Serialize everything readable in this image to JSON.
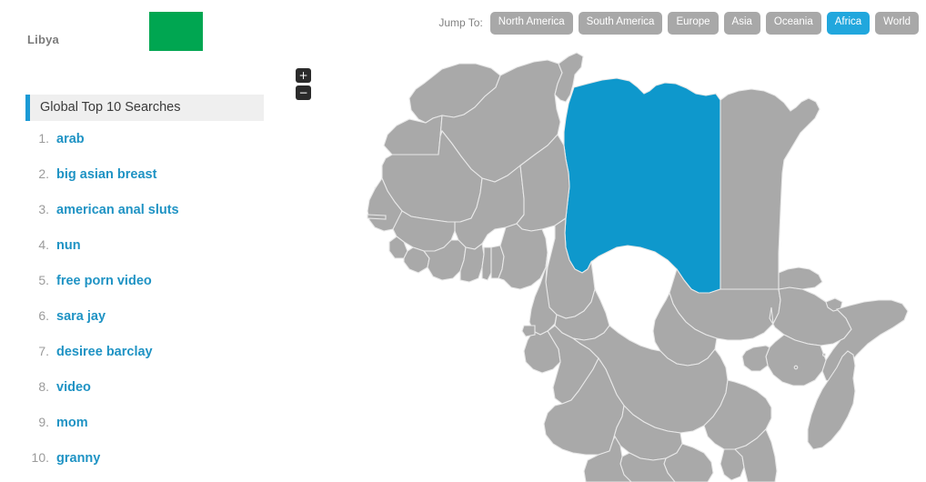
{
  "country": {
    "name": "Libya",
    "flag_color": "#00a651",
    "flag_label": "libya-flag"
  },
  "jump_nav": {
    "label": "Jump To:",
    "buttons": [
      {
        "label": "North America",
        "active": false
      },
      {
        "label": "South America",
        "active": false
      },
      {
        "label": "Europe",
        "active": false
      },
      {
        "label": "Asia",
        "active": false
      },
      {
        "label": "Oceania",
        "active": false
      },
      {
        "label": "Africa",
        "active": true
      },
      {
        "label": "World",
        "active": false
      }
    ],
    "active_color": "#21a7dd",
    "inactive_color": "#a8a8a8"
  },
  "map_controls": {
    "zoom_in_label": "+",
    "zoom_out_label": "−"
  },
  "searches": {
    "header": "Global Top 10 Searches",
    "accent_color": "#1b9ad5",
    "items": [
      {
        "rank": "1.",
        "term": "arab"
      },
      {
        "rank": "2.",
        "term": "big asian breast"
      },
      {
        "rank": "3.",
        "term": "american anal sluts"
      },
      {
        "rank": "4.",
        "term": "nun"
      },
      {
        "rank": "5.",
        "term": "free porn video"
      },
      {
        "rank": "6.",
        "term": "sara jay"
      },
      {
        "rank": "7.",
        "term": "desiree barclay"
      },
      {
        "rank": "8.",
        "term": "video"
      },
      {
        "rank": "9.",
        "term": "mom"
      },
      {
        "rank": "10.",
        "term": "granny"
      }
    ]
  },
  "map": {
    "region": "Africa",
    "selected_country": "Libya",
    "selected_color": "#0e98cc",
    "land_color": "#a9a9a9",
    "border_color": "#e8e8e8",
    "background_color": "#ffffff"
  }
}
